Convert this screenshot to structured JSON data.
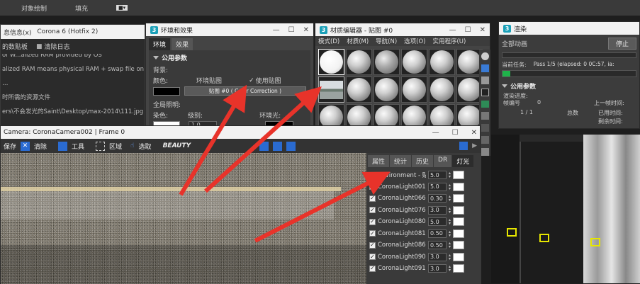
{
  "top_menu": {
    "item1": "对象绘制",
    "item2": "填充"
  },
  "log_window": {
    "title_left": "息信息(x)",
    "title_right": "Corona 6 (Hotfix 2)",
    "btn1": "的数贴板",
    "btn2": "清除日志",
    "lines": [
      "of W...alized RAM provided by OS",
      "alized RAM means physical RAM + swap file on H",
      "…",
      "时所需的资源文件",
      "ers\\不会发光的Saint\\Desktop\\max-2014\\111.jpg"
    ]
  },
  "env_window": {
    "title": "环境和效果",
    "tabs": [
      "环境",
      "效果"
    ],
    "section": "公用参数",
    "background_label": "背景:",
    "color_label": "颜色:",
    "env_map_label": "环境贴图",
    "use_map_label": "使用贴图",
    "map_button": "贴图 #0  ( Color Correction )",
    "global_lighting": "全局照明:",
    "tint_label": "染色:",
    "level_label": "级别:",
    "level_value": "1.0",
    "ambient_label": "环境光:"
  },
  "mat_window": {
    "title": "材质编辑器 - 贴图 #0",
    "menu": [
      "模式(D)",
      "材质(M)",
      "导航(N)",
      "选项(O)",
      "实用程序(U)"
    ]
  },
  "render_window": {
    "title": "渲染",
    "all_anim": "全部动画",
    "stop_btn": "停止",
    "current_task_label": "当前任务:",
    "current_task_value": "Pass 1/5 (elapsed: 0 0C:57, ia:",
    "section": "公用参数",
    "render_progress": "渲染进度:",
    "frame_label": "帧编号",
    "frame_value": "0",
    "frame_fraction": "1 / 1",
    "total_label": "总数",
    "last_frame_time": "上一帧时间:",
    "elapsed_time": "已用时间:",
    "remaining_time": "剩余时间:",
    "progress": 0.06
  },
  "frame_window": {
    "title": "Camera: CoronaCamera002 | Frame 0",
    "toolbar": [
      "保存",
      "清除",
      "工具",
      "区域",
      "选取",
      "BEAUTY"
    ],
    "panel_tabs": [
      "属性",
      "统计",
      "历史",
      "DR",
      "灯光"
    ],
    "lights": [
      {
        "name": "Environment - 贴",
        "value": "5.0"
      },
      {
        "name": "CoronaLight001:",
        "value": "5.0"
      },
      {
        "name": "CoronaLight066:",
        "value": "0.30"
      },
      {
        "name": "CoronaLight076:",
        "value": "3.0"
      },
      {
        "name": "CoronaLight080:",
        "value": "5.0"
      },
      {
        "name": "CoronaLight081:",
        "value": "0.50"
      },
      {
        "name": "CoronaLight086:",
        "value": "0.50"
      },
      {
        "name": "CoronaLight090:",
        "value": "3.0"
      },
      {
        "name": "CoronaLight091:",
        "value": "3.0"
      }
    ]
  }
}
